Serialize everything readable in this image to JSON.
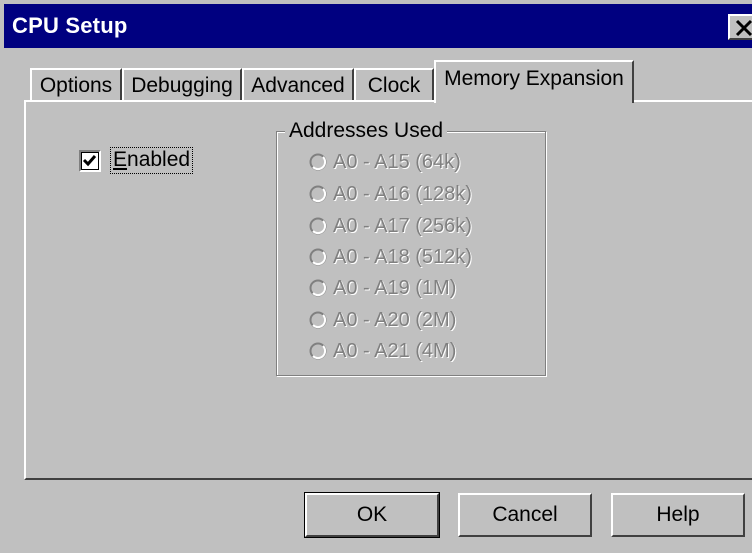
{
  "window": {
    "title": "CPU Setup"
  },
  "tabs": [
    {
      "label": "Options"
    },
    {
      "label": "Debugging"
    },
    {
      "label": "Advanced"
    },
    {
      "label": "Clock"
    },
    {
      "label": "Memory Expansion",
      "selected": true
    }
  ],
  "memory_expansion": {
    "enabled_label": "Enabled",
    "enabled_checked": true,
    "group_title": "Addresses Used",
    "group_enabled": false,
    "options": [
      {
        "label": "A0 - A15  (64k)"
      },
      {
        "label": "A0 - A16  (128k)"
      },
      {
        "label": "A0 - A17  (256k)"
      },
      {
        "label": "A0 - A18  (512k)"
      },
      {
        "label": "A0 - A19  (1M)"
      },
      {
        "label": "A0 - A20  (2M)"
      },
      {
        "label": "A0 - A21  (4M)"
      }
    ]
  },
  "buttons": {
    "ok": "OK",
    "cancel": "Cancel",
    "help": "Help"
  },
  "colors": {
    "titlebar": "#000080",
    "face": "#c0c0c0",
    "disabled_text": "#808080"
  }
}
